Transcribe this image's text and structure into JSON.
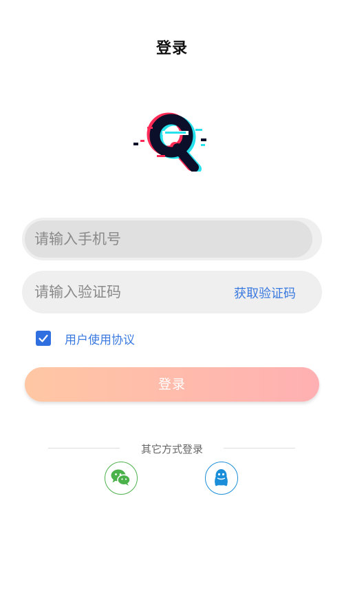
{
  "header": {
    "title": "登录"
  },
  "logo": {
    "name": "app-logo-q"
  },
  "form": {
    "phone_placeholder": "请输入手机号",
    "code_placeholder": "请输入验证码",
    "get_code_label": "获取验证码",
    "agreement_label": "用户使用协议",
    "agreement_checked": true,
    "login_label": "登录"
  },
  "other_login": {
    "label": "其它方式登录",
    "options": [
      {
        "name": "wechat-icon",
        "color": "#4bb14b"
      },
      {
        "name": "qq-icon",
        "color": "#1a8ed8"
      }
    ]
  },
  "colors": {
    "accent_blue": "#3a7ae0",
    "button_gradient_start": "#ffc7a4",
    "button_gradient_end": "#ffb0b3",
    "logo_red": "#ff2a55",
    "logo_cyan": "#25e2ec",
    "logo_dark": "#0b0f2a"
  }
}
